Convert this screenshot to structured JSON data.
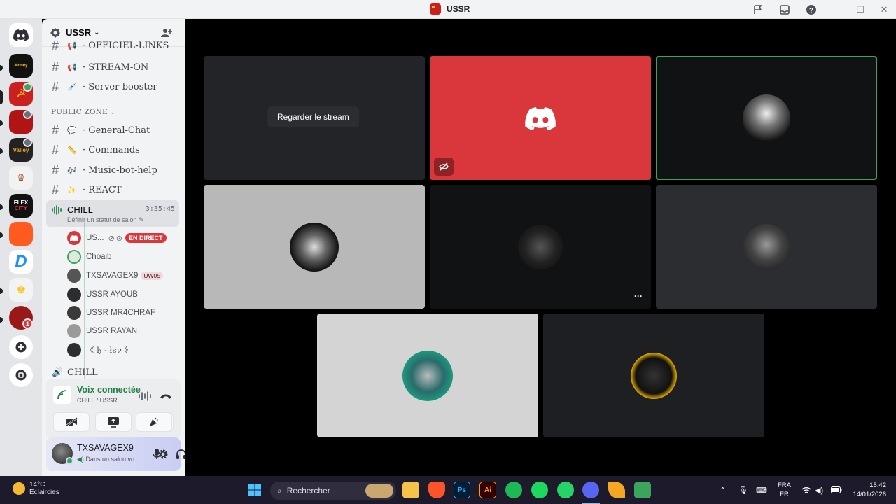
{
  "window": {
    "title": "USSR",
    "title_icons": [
      "inbox-flag-icon",
      "inbox-icon",
      "help-icon"
    ],
    "controls": [
      "—",
      "☐",
      "✕"
    ]
  },
  "rail": {
    "servers": [
      {
        "name": "Honey",
        "color": "#111111"
      },
      {
        "name": "USSR",
        "color": "#cc1f1f"
      },
      {
        "name": "Server",
        "color": "#b01515"
      },
      {
        "name": "Valley",
        "color": "#222222"
      },
      {
        "name": "Emblem",
        "color": "#f2f2f2"
      },
      {
        "name": "FLEX CITY",
        "color": "#111111"
      },
      {
        "name": "Server",
        "color": "#ff5a1f"
      },
      {
        "name": "D",
        "color": "#ffffff"
      },
      {
        "name": "Light",
        "color": "#f2f3f5"
      },
      {
        "name": "Server",
        "color": "#991818"
      }
    ],
    "badge_count": "1"
  },
  "sidebar": {
    "guild_name": "USSR",
    "channels_top": [
      {
        "name": "· OFFICIEL-LINKS",
        "emoji": "📢"
      },
      {
        "name": "· STREAM-ON",
        "emoji": "📢"
      },
      {
        "name": "· Server-booster",
        "emoji": "💉"
      }
    ],
    "category": "PUBLIC ZONE",
    "channels": [
      {
        "name": "· General-Chat",
        "emoji": "💬"
      },
      {
        "name": "· Commands",
        "emoji": "📏"
      },
      {
        "name": "· Music-bot-help",
        "emoji": "🎶"
      },
      {
        "name": "· REACT",
        "emoji": "✨"
      }
    ],
    "voice_channel": {
      "name": "CHILL",
      "time": "3:35:45",
      "status": "Définir un statut de salon"
    },
    "members": [
      {
        "name": "US...",
        "live": "EN DIRECT"
      },
      {
        "name": "Choaib"
      },
      {
        "name": "TXSAVAGEX9",
        "tag": "UW05"
      },
      {
        "name": "USSR AYOUB"
      },
      {
        "name": "USSR MR4CHRAF"
      },
      {
        "name": "USSR RAYAN"
      },
      {
        "name": "《 ђ - łєν 》"
      }
    ],
    "voice_channel_2": "CHILL"
  },
  "voice_panel": {
    "status": "Voix connectée",
    "location": "CHILL / USSR"
  },
  "user": {
    "name": "TXSAVAGEX9",
    "status": "Dans un salon vo..."
  },
  "stage": {
    "watch_label": "Regarder le stream",
    "more_label": "···"
  },
  "taskbar": {
    "temperature": "14°C",
    "weather": "Eclaircies",
    "search_placeholder": "Rechercher",
    "lang_top": "FRA",
    "lang_bottom": "FR",
    "time": "15:42",
    "date": "14/01/2026"
  },
  "colors": {
    "discord_blurple": "#5865f2",
    "discord_red": "#da373c",
    "speaking_green": "#3ba55d"
  }
}
